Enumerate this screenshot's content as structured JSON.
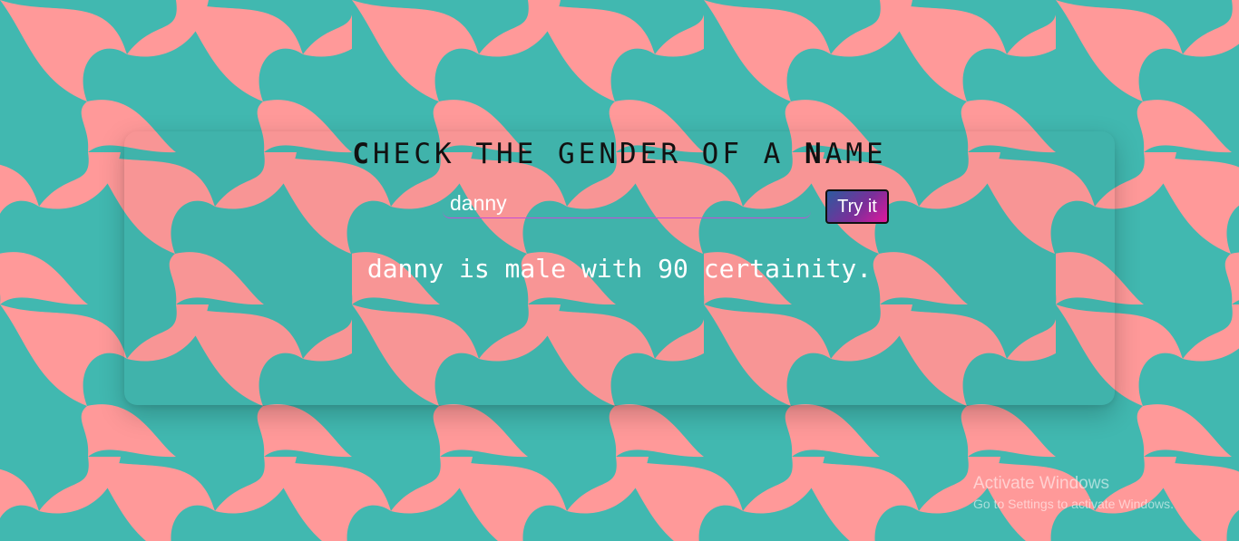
{
  "page": {
    "title_first_letter": "C",
    "title_part1": "HECK THE ",
    "title_g_letter": "G",
    "title_part2": "ENDER OF A ",
    "title_n_letter": "N",
    "title_part3": "AME"
  },
  "form": {
    "name_value": "danny",
    "button_label": "Try it"
  },
  "result": {
    "text": "danny is male with 90 certainity."
  },
  "watermark": {
    "title": "Activate Windows",
    "subtitle": "Go to Settings to activate Windows."
  },
  "colors": {
    "pattern_teal": "#41b8b0",
    "pattern_pink": "#ff9999",
    "input_underline": "#c44dd6",
    "button_gradient_start": "#2c5a9e",
    "button_gradient_end": "#e0179c"
  }
}
